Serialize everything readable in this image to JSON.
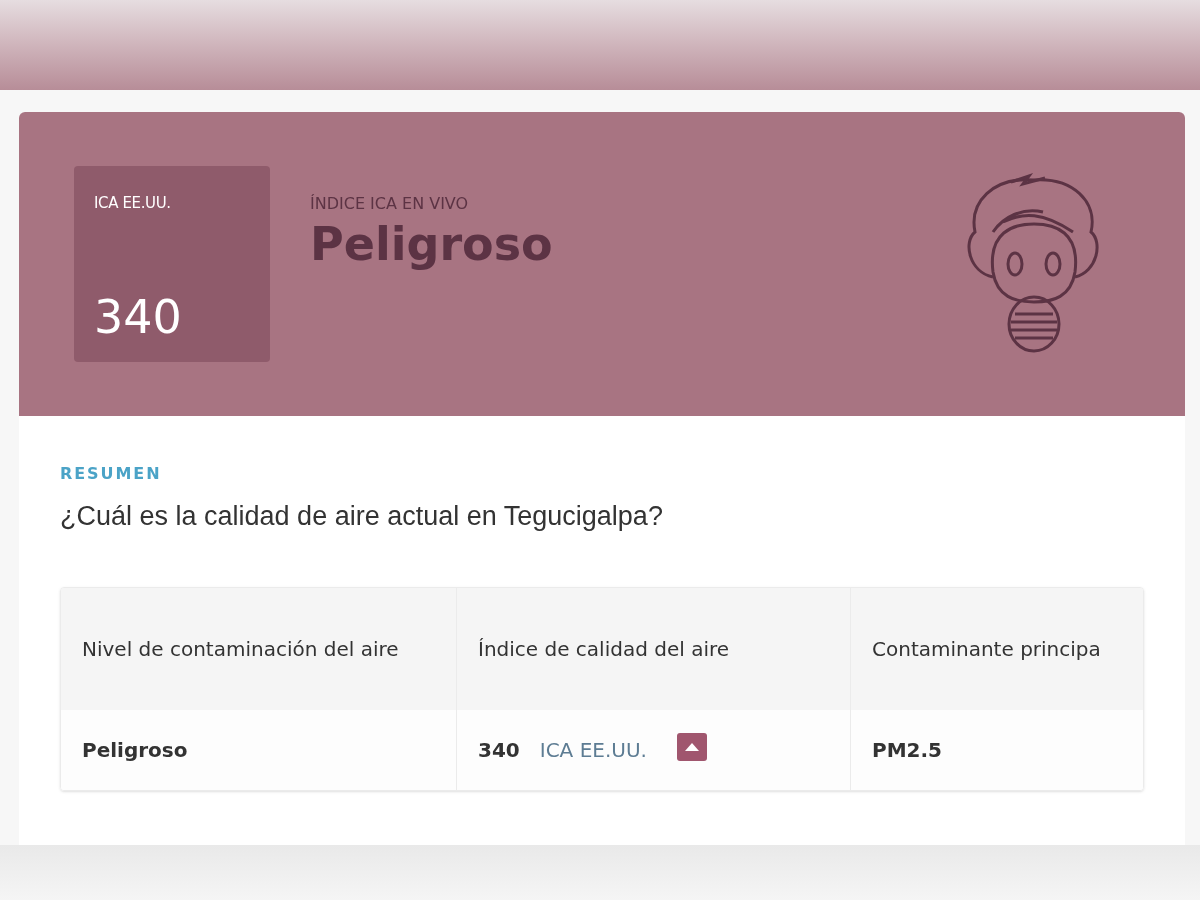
{
  "hero": {
    "badge_label": "ICA EE.UU.",
    "badge_value": "340",
    "eyebrow": "ÍNDICE ICA EN VIVO",
    "level": "Peligroso"
  },
  "summary": {
    "eyebrow": "RESUMEN",
    "heading": "¿Cuál es la calidad de aire actual en Tegucigalpa?"
  },
  "table": {
    "columns": [
      "Nivel de contaminación del aire",
      "Índice de calidad del aire",
      "Contaminante principa"
    ],
    "rows": [
      {
        "level": "Peligroso",
        "index": "340",
        "unit": "ICA EE.UU.",
        "pollutant": "PM2.5"
      }
    ]
  }
}
